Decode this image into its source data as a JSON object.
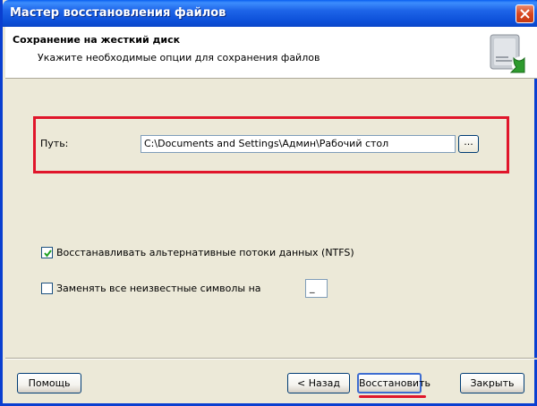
{
  "window": {
    "title": "Мастер восстановления файлов"
  },
  "header": {
    "title": "Сохранение на жесткий диск",
    "subtitle": "Укажите необходимые опции для сохранения файлов",
    "icon": "hard-drive-save-icon"
  },
  "path": {
    "label": "Путь:",
    "value": "C:\\Documents and Settings\\Админ\\Рабочий стол",
    "browse_label": "..."
  },
  "options": {
    "alt_streams": {
      "label": "Восстанавливать альтернативные потоки данных (NTFS)",
      "checked": true
    },
    "replace_unknown": {
      "label": "Заменять все неизвестные символы на",
      "checked": false,
      "value": "_"
    }
  },
  "buttons": {
    "help": "Помощь",
    "back": "< Назад",
    "restore": "Восстановить",
    "close": "Закрыть"
  },
  "colors": {
    "titlebar": "#0a5ff0",
    "highlight": "#e0162b",
    "face": "#ece9d8"
  }
}
